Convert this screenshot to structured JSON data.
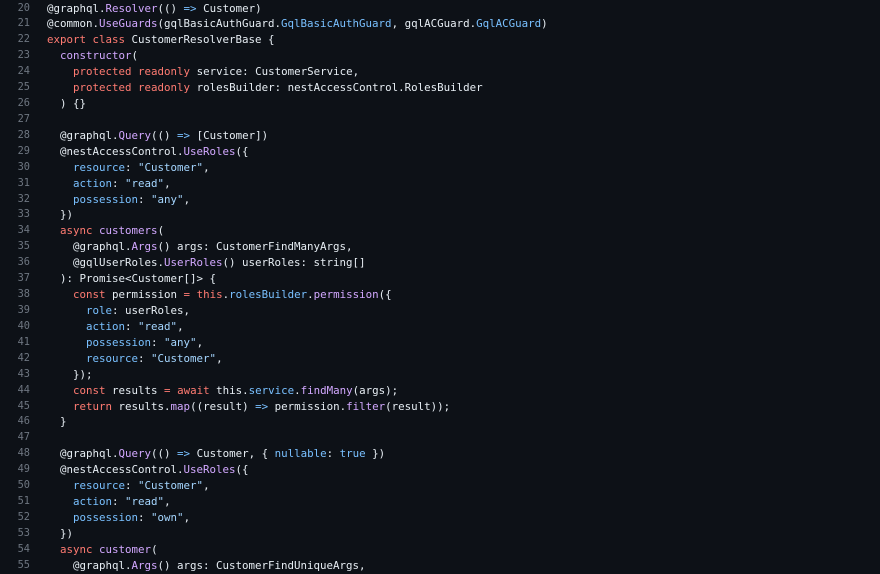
{
  "editor": {
    "lines": [
      {
        "n": "20",
        "tokens": [
          [
            "plain",
            "@graphql."
          ],
          [
            "function",
            "Resolver"
          ],
          [
            "plain",
            "(() "
          ],
          [
            "constant",
            "=>"
          ],
          [
            "plain",
            " Customer)"
          ]
        ]
      },
      {
        "n": "21",
        "tokens": [
          [
            "plain",
            "@common."
          ],
          [
            "function",
            "UseGuards"
          ],
          [
            "plain",
            "(gqlBasicAuthGuard."
          ],
          [
            "prop",
            "GqlBasicAuthGuard"
          ],
          [
            "plain",
            ", gqlACGuard."
          ],
          [
            "prop",
            "GqlACGuard"
          ],
          [
            "plain",
            ")"
          ]
        ]
      },
      {
        "n": "22",
        "tokens": [
          [
            "keyword",
            "export"
          ],
          [
            "plain",
            " "
          ],
          [
            "keyword",
            "class"
          ],
          [
            "plain",
            " CustomerResolverBase {"
          ]
        ]
      },
      {
        "n": "23",
        "tokens": [
          [
            "plain",
            "  "
          ],
          [
            "function",
            "constructor"
          ],
          [
            "plain",
            "("
          ]
        ]
      },
      {
        "n": "24",
        "tokens": [
          [
            "plain",
            "    "
          ],
          [
            "keyword",
            "protected"
          ],
          [
            "plain",
            " "
          ],
          [
            "keyword",
            "readonly"
          ],
          [
            "plain",
            " service: CustomerService,"
          ]
        ]
      },
      {
        "n": "25",
        "tokens": [
          [
            "plain",
            "    "
          ],
          [
            "keyword",
            "protected"
          ],
          [
            "plain",
            " "
          ],
          [
            "keyword",
            "readonly"
          ],
          [
            "plain",
            " rolesBuilder: nestAccessControl.RolesBuilder"
          ]
        ]
      },
      {
        "n": "26",
        "tokens": [
          [
            "plain",
            "  ) {}"
          ]
        ]
      },
      {
        "n": "27",
        "tokens": [
          [
            "plain",
            ""
          ]
        ]
      },
      {
        "n": "28",
        "tokens": [
          [
            "plain",
            "  @graphql."
          ],
          [
            "function",
            "Query"
          ],
          [
            "plain",
            "(() "
          ],
          [
            "constant",
            "=>"
          ],
          [
            "plain",
            " [Customer])"
          ]
        ]
      },
      {
        "n": "29",
        "tokens": [
          [
            "plain",
            "  @nestAccessControl."
          ],
          [
            "function",
            "UseRoles"
          ],
          [
            "plain",
            "({"
          ]
        ]
      },
      {
        "n": "30",
        "tokens": [
          [
            "plain",
            "    "
          ],
          [
            "prop",
            "resource"
          ],
          [
            "plain",
            ": "
          ],
          [
            "string",
            "\"Customer\""
          ],
          [
            "plain",
            ","
          ]
        ]
      },
      {
        "n": "31",
        "tokens": [
          [
            "plain",
            "    "
          ],
          [
            "prop",
            "action"
          ],
          [
            "plain",
            ": "
          ],
          [
            "string",
            "\"read\""
          ],
          [
            "plain",
            ","
          ]
        ]
      },
      {
        "n": "32",
        "tokens": [
          [
            "plain",
            "    "
          ],
          [
            "prop",
            "possession"
          ],
          [
            "plain",
            ": "
          ],
          [
            "string",
            "\"any\""
          ],
          [
            "plain",
            ","
          ]
        ]
      },
      {
        "n": "33",
        "tokens": [
          [
            "plain",
            "  })"
          ]
        ]
      },
      {
        "n": "34",
        "tokens": [
          [
            "plain",
            "  "
          ],
          [
            "keyword",
            "async"
          ],
          [
            "plain",
            " "
          ],
          [
            "function",
            "customers"
          ],
          [
            "plain",
            "("
          ]
        ]
      },
      {
        "n": "35",
        "tokens": [
          [
            "plain",
            "    @graphql."
          ],
          [
            "function",
            "Args"
          ],
          [
            "plain",
            "() args: CustomerFindManyArgs,"
          ]
        ]
      },
      {
        "n": "36",
        "tokens": [
          [
            "plain",
            "    @gqlUserRoles."
          ],
          [
            "function",
            "UserRoles"
          ],
          [
            "plain",
            "() userRoles: string[]"
          ]
        ]
      },
      {
        "n": "37",
        "tokens": [
          [
            "plain",
            "  ): Promise<Customer[]> {"
          ]
        ]
      },
      {
        "n": "38",
        "tokens": [
          [
            "plain",
            "    "
          ],
          [
            "keyword",
            "const"
          ],
          [
            "plain",
            " permission "
          ],
          [
            "keyword",
            "="
          ],
          [
            "plain",
            " "
          ],
          [
            "keyword",
            "this"
          ],
          [
            "plain",
            "."
          ],
          [
            "prop",
            "rolesBuilder"
          ],
          [
            "plain",
            "."
          ],
          [
            "function",
            "permission"
          ],
          [
            "plain",
            "({"
          ]
        ]
      },
      {
        "n": "39",
        "tokens": [
          [
            "plain",
            "      "
          ],
          [
            "prop",
            "role"
          ],
          [
            "plain",
            ": userRoles,"
          ]
        ]
      },
      {
        "n": "40",
        "tokens": [
          [
            "plain",
            "      "
          ],
          [
            "prop",
            "action"
          ],
          [
            "plain",
            ": "
          ],
          [
            "string",
            "\"read\""
          ],
          [
            "plain",
            ","
          ]
        ]
      },
      {
        "n": "41",
        "tokens": [
          [
            "plain",
            "      "
          ],
          [
            "prop",
            "possession"
          ],
          [
            "plain",
            ": "
          ],
          [
            "string",
            "\"any\""
          ],
          [
            "plain",
            ","
          ]
        ]
      },
      {
        "n": "42",
        "tokens": [
          [
            "plain",
            "      "
          ],
          [
            "prop",
            "resource"
          ],
          [
            "plain",
            ": "
          ],
          [
            "string",
            "\"Customer\""
          ],
          [
            "plain",
            ","
          ]
        ]
      },
      {
        "n": "43",
        "tokens": [
          [
            "plain",
            "    });"
          ]
        ]
      },
      {
        "n": "44",
        "tokens": [
          [
            "plain",
            "    "
          ],
          [
            "keyword",
            "const"
          ],
          [
            "plain",
            " results "
          ],
          [
            "keyword",
            "="
          ],
          [
            "plain",
            " "
          ],
          [
            "keyword",
            "await"
          ],
          [
            "plain",
            " this."
          ],
          [
            "prop",
            "service"
          ],
          [
            "plain",
            "."
          ],
          [
            "function",
            "findMany"
          ],
          [
            "plain",
            "(args);"
          ]
        ]
      },
      {
        "n": "45",
        "tokens": [
          [
            "plain",
            "    "
          ],
          [
            "keyword",
            "return"
          ],
          [
            "plain",
            " results."
          ],
          [
            "function",
            "map"
          ],
          [
            "plain",
            "((result) "
          ],
          [
            "constant",
            "=>"
          ],
          [
            "plain",
            " permission."
          ],
          [
            "function",
            "filter"
          ],
          [
            "plain",
            "(result));"
          ]
        ]
      },
      {
        "n": "46",
        "tokens": [
          [
            "plain",
            "  }"
          ]
        ]
      },
      {
        "n": "47",
        "tokens": [
          [
            "plain",
            ""
          ]
        ]
      },
      {
        "n": "48",
        "tokens": [
          [
            "plain",
            "  @graphql."
          ],
          [
            "function",
            "Query"
          ],
          [
            "plain",
            "(() "
          ],
          [
            "constant",
            "=>"
          ],
          [
            "plain",
            " Customer, { "
          ],
          [
            "prop",
            "nullable"
          ],
          [
            "plain",
            ": "
          ],
          [
            "constant",
            "true"
          ],
          [
            "plain",
            " })"
          ]
        ]
      },
      {
        "n": "49",
        "tokens": [
          [
            "plain",
            "  @nestAccessControl."
          ],
          [
            "function",
            "UseRoles"
          ],
          [
            "plain",
            "({"
          ]
        ]
      },
      {
        "n": "50",
        "tokens": [
          [
            "plain",
            "    "
          ],
          [
            "prop",
            "resource"
          ],
          [
            "plain",
            ": "
          ],
          [
            "string",
            "\"Customer\""
          ],
          [
            "plain",
            ","
          ]
        ]
      },
      {
        "n": "51",
        "tokens": [
          [
            "plain",
            "    "
          ],
          [
            "prop",
            "action"
          ],
          [
            "plain",
            ": "
          ],
          [
            "string",
            "\"read\""
          ],
          [
            "plain",
            ","
          ]
        ]
      },
      {
        "n": "52",
        "tokens": [
          [
            "plain",
            "    "
          ],
          [
            "prop",
            "possession"
          ],
          [
            "plain",
            ": "
          ],
          [
            "string",
            "\"own\""
          ],
          [
            "plain",
            ","
          ]
        ]
      },
      {
        "n": "53",
        "tokens": [
          [
            "plain",
            "  })"
          ]
        ]
      },
      {
        "n": "54",
        "tokens": [
          [
            "plain",
            "  "
          ],
          [
            "keyword",
            "async"
          ],
          [
            "plain",
            " "
          ],
          [
            "function",
            "customer"
          ],
          [
            "plain",
            "("
          ]
        ]
      },
      {
        "n": "55",
        "tokens": [
          [
            "plain",
            "    @graphql."
          ],
          [
            "function",
            "Args"
          ],
          [
            "plain",
            "() args: CustomerFindUniqueArgs,"
          ]
        ]
      }
    ]
  },
  "colors": {
    "background": "#0d1117",
    "line_number": "#6e7681",
    "plain": "#e6edf3",
    "keyword": "#ff7b72",
    "string": "#a5d6ff",
    "function": "#d2a8ff",
    "constant": "#79c0ff"
  }
}
